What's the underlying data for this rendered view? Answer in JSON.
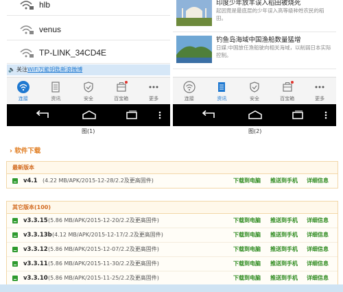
{
  "phone1": {
    "wifi_networks": [
      {
        "name": "hlb"
      },
      {
        "name": "venus"
      },
      {
        "name": "TP-LINK_34CD4E"
      }
    ],
    "notice": {
      "prefix": "关注",
      "link": "WiFi万能钥匙新浪微博"
    },
    "tabs": [
      {
        "label": "连接",
        "icon": "wifi-icon"
      },
      {
        "label": "资讯",
        "icon": "news-icon"
      },
      {
        "label": "安全",
        "icon": "shield-icon"
      },
      {
        "label": "百宝箱",
        "icon": "toolbox-icon"
      },
      {
        "label": "更多",
        "icon": "more-icon"
      }
    ],
    "caption": "图(1)"
  },
  "phone2": {
    "news": [
      {
        "title": "印度少年放羊误入稻田被烧死",
        "desc": "起因竟是最底层的少年误入高等级种姓农民的稻田。"
      },
      {
        "title": "钓鱼岛海域中国渔船数量猛增",
        "desc": "日媒:中国放任渔船驶向相关海域，以削弱日本实际控制。"
      }
    ],
    "tabs": [
      {
        "label": "连接",
        "icon": "wifi-icon"
      },
      {
        "label": "资讯",
        "icon": "news-icon"
      },
      {
        "label": "安全",
        "icon": "shield-icon"
      },
      {
        "label": "百宝箱",
        "icon": "toolbox-icon"
      },
      {
        "label": "更多",
        "icon": "more-icon"
      }
    ],
    "caption": "图(2)"
  },
  "colors": {
    "accent": "#1e78d0",
    "orange": "#e07b1e",
    "green": "#2d8a1e"
  },
  "download": {
    "section_title": "软件下载",
    "latest": {
      "header": "最新版本",
      "items": [
        {
          "version": "v4.1",
          "meta": "(4.22 MB/APK/2015-12-28/2.2及更高固件)"
        }
      ]
    },
    "other": {
      "header": "其它版本(100)",
      "items": [
        {
          "version": "v3.3.15",
          "meta": "(5.86 MB/APK/2015-12-20/2.2及更高固件)"
        },
        {
          "version": "v3.3.13b",
          "meta": "(4.12 MB/APK/2015-12-17/2.2及更高固件)"
        },
        {
          "version": "v3.3.12",
          "meta": "(5.86 MB/APK/2015-12-07/2.2及更高固件)"
        },
        {
          "version": "v3.3.11",
          "meta": "(5.86 MB/APK/2015-11-30/2.2及更高固件)"
        },
        {
          "version": "v3.3.10",
          "meta": "(5.86 MB/APK/2015-11-25/2.2及更高固件)"
        }
      ]
    },
    "actions": {
      "to_pc": "下载到电脑",
      "to_phone": "推送到手机",
      "details": "详细信息"
    }
  }
}
